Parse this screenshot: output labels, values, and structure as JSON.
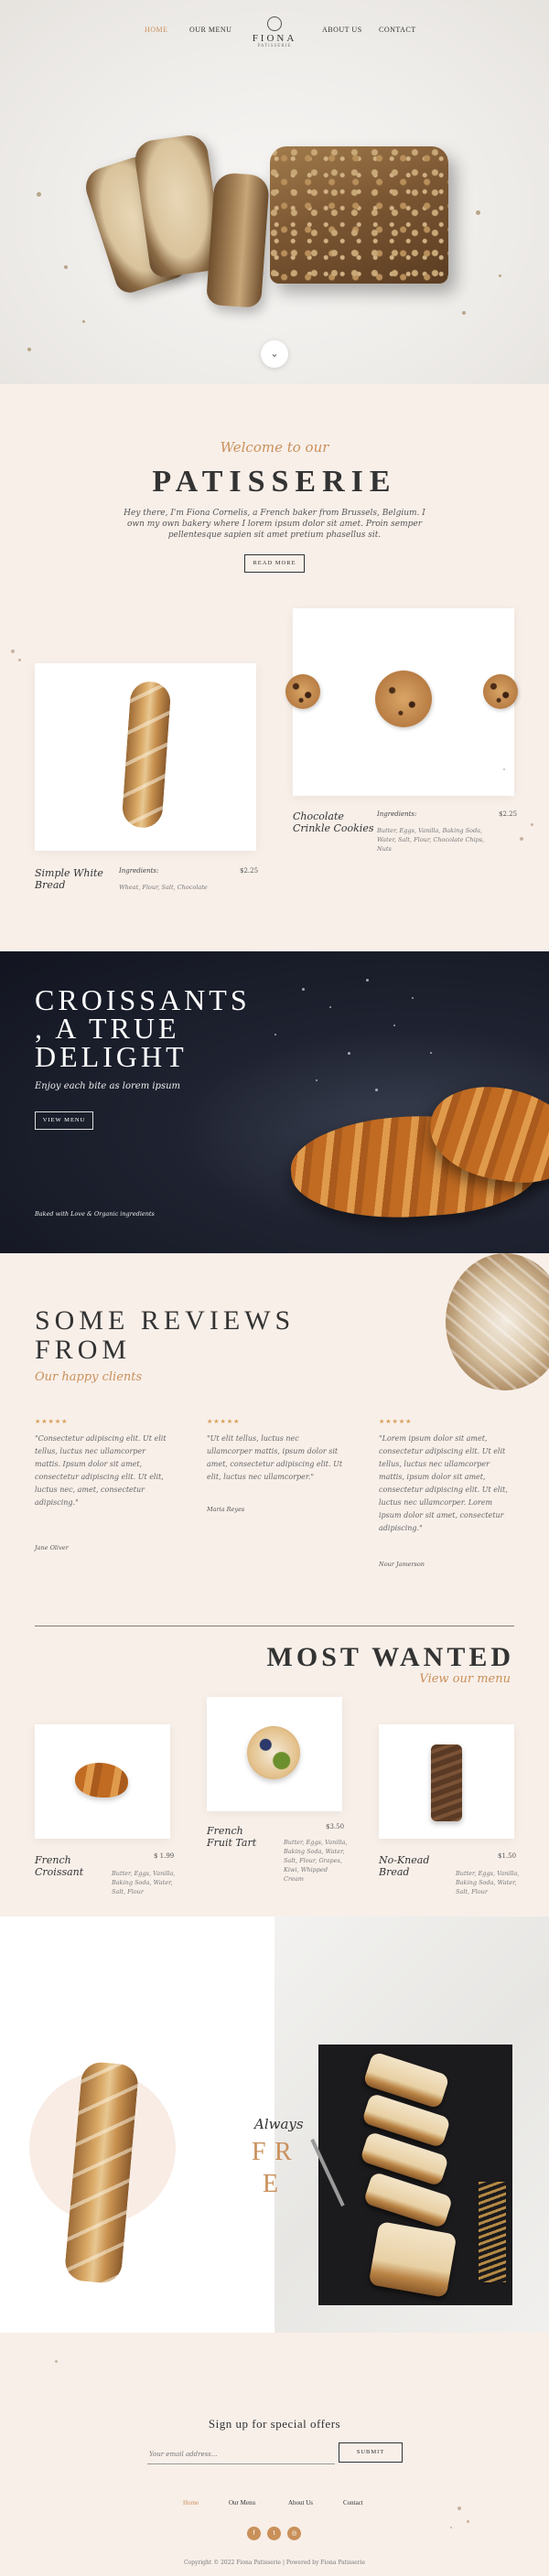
{
  "nav": {
    "items": [
      {
        "label": "HOME",
        "active": true
      },
      {
        "label": "OUR MENU",
        "active": false
      },
      {
        "label": "ABOUT US",
        "active": false
      },
      {
        "label": "CONTACT",
        "active": false
      }
    ],
    "logo_name": "FIONA",
    "logo_sub": "PATISSERIE",
    "scroll_icon": "chevron-down-icon"
  },
  "intro": {
    "welcome": "Welcome to our",
    "title": "PATISSERIE",
    "description": "Hey there, I'm Fiona Cornelis, a French baker from Brussels, Belgium. I own my own bakery where I lorem ipsum dolor sit amet. Proin semper pellentesque sapien sit amet pretium phasellus sit.",
    "button": "READ MORE"
  },
  "featured": [
    {
      "name": "Simple White Bread",
      "ingredients_label": "Ingredients:",
      "ingredients": "Wheat, Flour, Salt, Chocolate",
      "price": "$2.25"
    },
    {
      "name": "Chocolate Crinkle Cookies",
      "ingredients_label": "Ingredients:",
      "ingredients": "Butter, Eggs, Vanilla, Baking Soda, Water, Salt, Flour, Chocolate Chips, Nuts",
      "price": "$2.25"
    }
  ],
  "croissant_banner": {
    "title_line1": "CROISSANTS",
    "title_line2": ", A TRUE",
    "title_line3": "DELIGHT",
    "subtitle": "Enjoy each bite as lorem ipsum",
    "button": "VIEW MENU",
    "footnote": "Baked with Love & Organic ingredients"
  },
  "reviews": {
    "title_line1": "SOME REVIEWS",
    "title_line2": "FROM",
    "subtitle": "Our happy clients",
    "stars": "★★★★★",
    "items": [
      {
        "text": "\"Consectetur adipiscing elit. Ut elit tellus, luctus nec ullamcorper mattis. Ipsum dolor sit amet, consectetur adipiscing elit. Ut elit, luctus nec, amet, consectetur adipiscing.\"",
        "author": "Jane Oliver"
      },
      {
        "text": "\"Ut elit tellus, luctus nec ullamcorper mattis, ipsum dolor sit amet, consectetur adipiscing elit. Ut elit, luctus nec ullamcorper.\"",
        "author": "Maria Reyes"
      },
      {
        "text": "\"Lorem ipsum dolor sit amet, consectetur adipiscing elit. Ut elit tellus, luctus nec ullamcorper mattis, ipsum dolor sit amet, consectetur adipiscing elit. Ut elit, luctus nec ullamcorper. Lorem ipsum dolor sit amet, consectetur adipiscing.\"",
        "author": "Nour Jamerson"
      }
    ]
  },
  "most_wanted": {
    "title": "MOST WANTED",
    "link": "View our menu",
    "items": [
      {
        "name": "French Croissant",
        "price": "$ 1.99",
        "ingredients": "Butter, Eggs, Vanilla, Baking Soda, Water, Salt, Flour"
      },
      {
        "name": "French Fruit Tart",
        "price": "$3.50",
        "ingredients": "Butter, Eggs, Vanilla, Baking Soda, Water, Salt, Flour, Grapes, Kiwi, Whipped Cream"
      },
      {
        "name": "No-Knead Bread",
        "price": "$1.50",
        "ingredients": "Butter, Eggs, Vanilla, Baking Soda, Water, Salt, Flour"
      }
    ]
  },
  "fresh": {
    "script": "Always",
    "letters": [
      "F",
      "R",
      "E"
    ]
  },
  "footer": {
    "newsletter_title": "Sign up for special offers",
    "email_placeholder": "Your email address...",
    "submit": "SUBMIT",
    "nav": [
      {
        "label": "Home",
        "active": true
      },
      {
        "label": "Our Menu",
        "active": false
      },
      {
        "label": "About Us",
        "active": false
      },
      {
        "label": "Contact",
        "active": false
      }
    ],
    "social": [
      {
        "icon": "facebook-icon",
        "glyph": "f"
      },
      {
        "icon": "twitter-icon",
        "glyph": "t"
      },
      {
        "icon": "instagram-icon",
        "glyph": "◎"
      }
    ],
    "copyright": "Copyright © 2022 Fiona Patisserie | Powered by Fiona Patisserie"
  },
  "colors": {
    "accent": "#c9905a",
    "background": "#f8efe9",
    "dark": "#1b1a1c"
  }
}
